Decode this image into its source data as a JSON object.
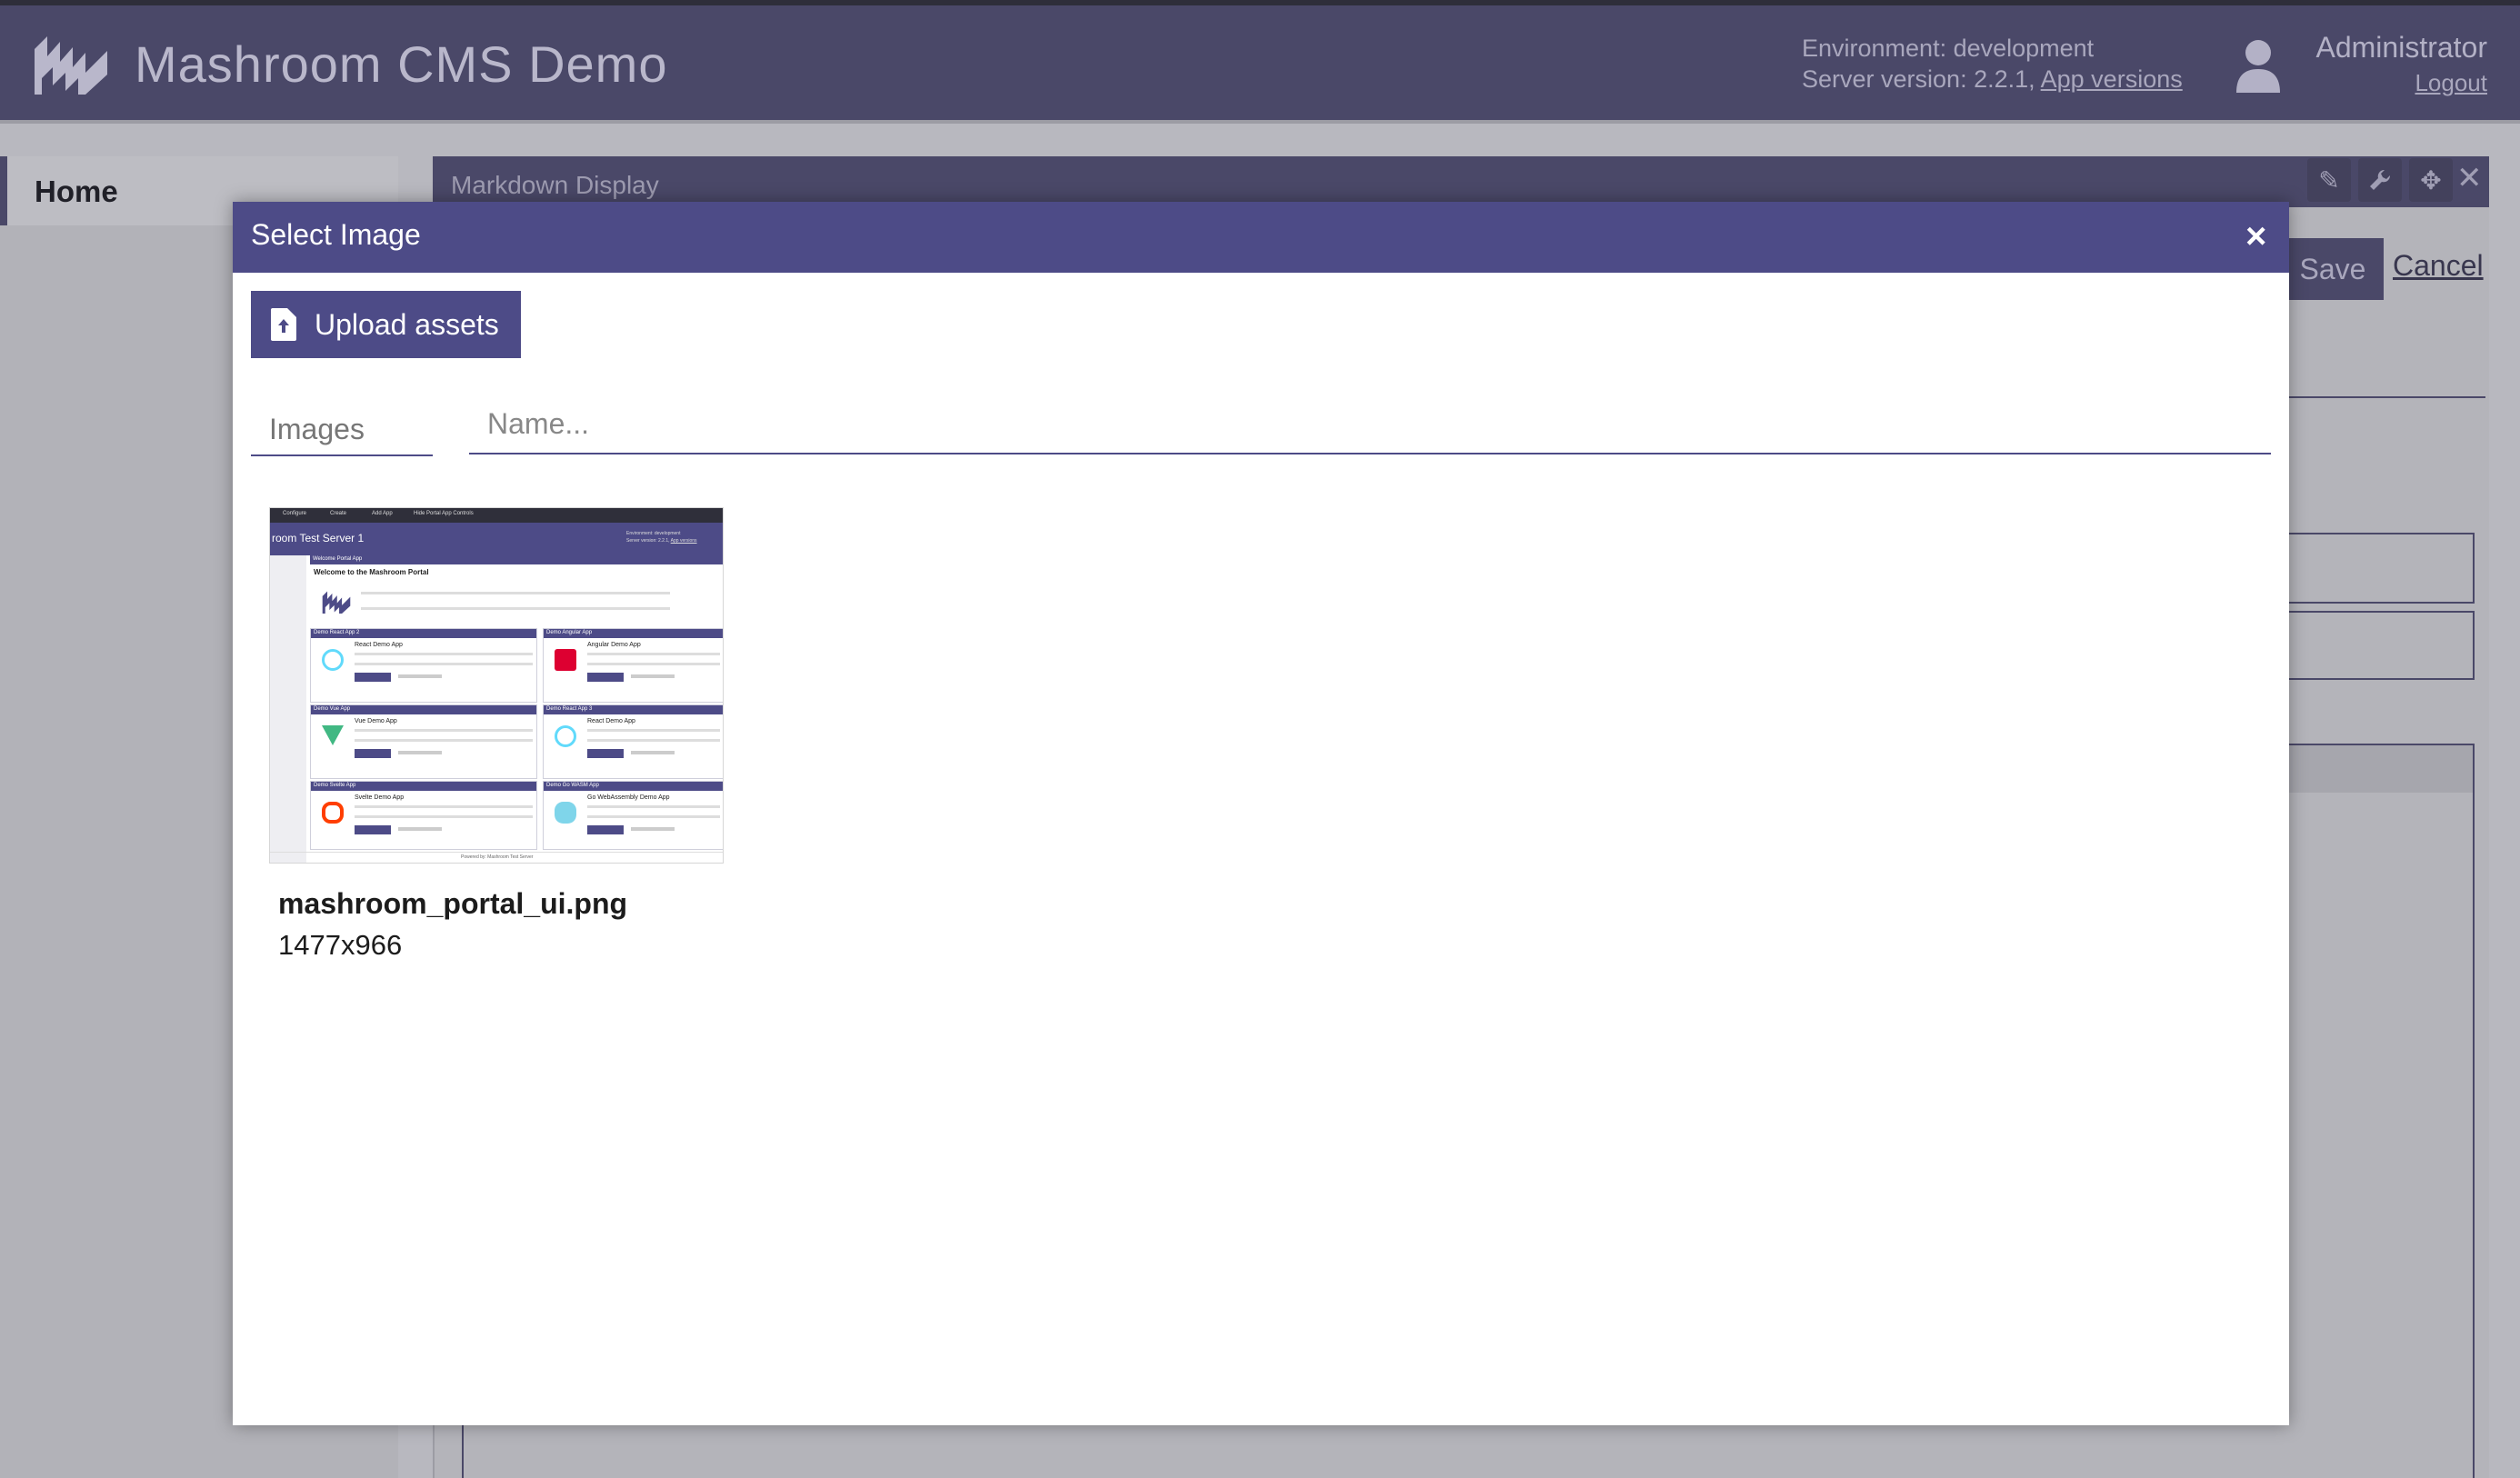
{
  "header": {
    "title": "Mashroom CMS Demo",
    "environment": "Environment: development",
    "server_version": "Server version: 2.2.1,",
    "app_versions_link": "App versions",
    "user_name": "Administrator",
    "logout": "Logout"
  },
  "sidebar": {
    "items": [
      {
        "label": "Home",
        "active": true
      }
    ]
  },
  "app_panel": {
    "title": "Markdown Display",
    "save_label": "Save",
    "cancel_label": "Cancel",
    "toolbar_icons": [
      "pencil-icon",
      "wrench-icon",
      "move-icon",
      "close-icon"
    ]
  },
  "modal": {
    "title": "Select Image",
    "close_glyph": "×",
    "upload_label": "Upload assets",
    "type_filter": "Images",
    "name_placeholder": "Name...",
    "assets": [
      {
        "file_name": "mashroom_portal_ui.png",
        "dimensions": "1477x966"
      }
    ]
  },
  "thumbnail": {
    "top_menu": [
      "Configure",
      "Create",
      "Add App",
      "Hide Portal App Controls"
    ],
    "title": "room Test Server 1",
    "env": "Environment: development",
    "env2": "Server version: 2.2.1,",
    "env_link": "App versions",
    "welcome_bar": "Welcome Portal App",
    "welcome_heading": "Welcome to the Mashroom Portal",
    "apps": [
      {
        "bar": "Demo React App 2",
        "name": "React Demo App"
      },
      {
        "bar": "Demo Angular App",
        "name": "Angular Demo App"
      },
      {
        "bar": "Demo Vue App",
        "name": "Vue Demo App"
      },
      {
        "bar": "Demo React App 3",
        "name": "React Demo App"
      },
      {
        "bar": "Demo Svelte App",
        "name": "Svelte Demo App"
      },
      {
        "bar": "Demo Go WASM App",
        "name": "Go WebAssembly Demo App"
      }
    ],
    "footer": "Powered by: Mashroom Test Server"
  },
  "colors": {
    "modal_accent": "#4d4b87",
    "header_dimmed": "#4a4868",
    "overlay_bg": "#b8b8bf"
  }
}
